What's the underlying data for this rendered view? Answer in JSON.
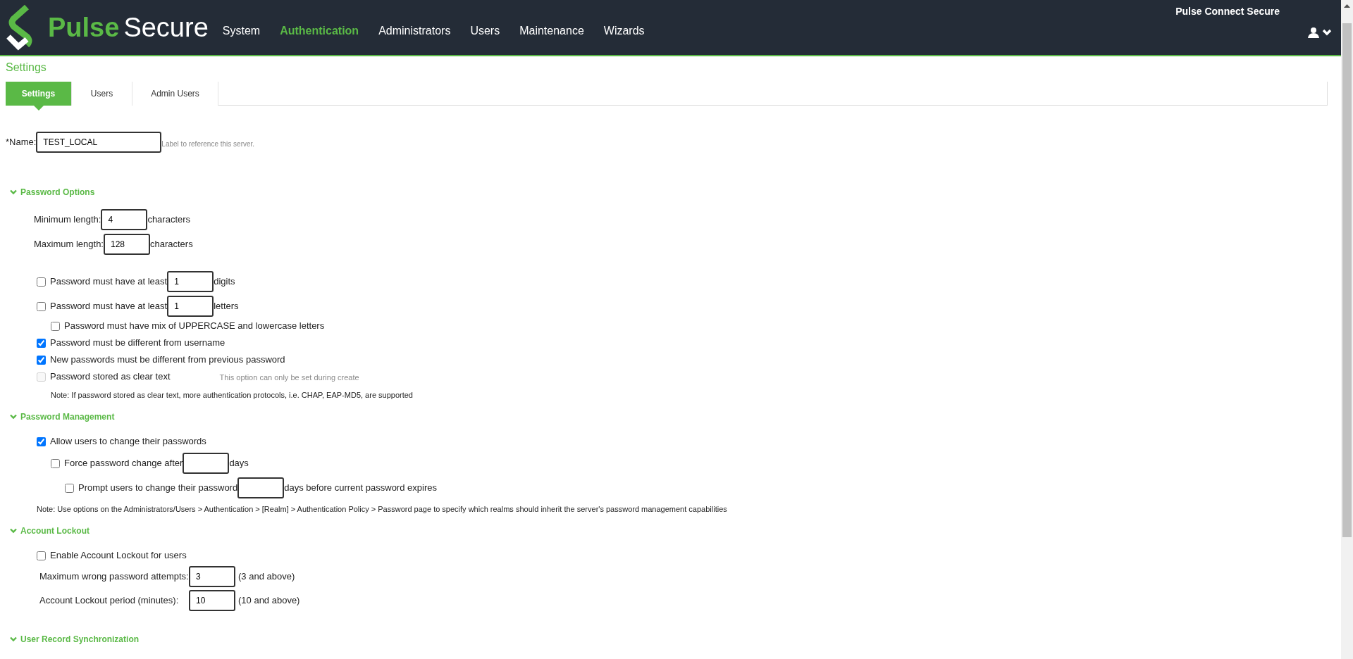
{
  "brand": {
    "first": "Pulse",
    "second": "Secure"
  },
  "product": "Pulse Connect Secure",
  "nav": [
    {
      "label": "System",
      "selected": false
    },
    {
      "label": "Authentication",
      "selected": true
    },
    {
      "label": "Administrators",
      "selected": false
    },
    {
      "label": "Users",
      "selected": false
    },
    {
      "label": "Maintenance",
      "selected": false
    },
    {
      "label": "Wizards",
      "selected": false
    }
  ],
  "page_title": "Settings",
  "tabs": [
    {
      "label": "Settings",
      "selected": true
    },
    {
      "label": "Users",
      "selected": false
    },
    {
      "label": "Admin Users",
      "selected": false
    }
  ],
  "name_field": {
    "label": "*Name:",
    "value": "TEST_LOCAL",
    "hint": "Label to reference this server."
  },
  "sections": [
    {
      "title": "Password Options",
      "expanded": true,
      "rows": [
        {
          "kind": "field",
          "label": "Minimum length:",
          "value": "4",
          "suffix": "characters"
        },
        {
          "kind": "field",
          "label": "Maximum length:",
          "value": "128",
          "suffix": "characters"
        },
        {
          "kind": "check_field",
          "checked": false,
          "label": "Password must have at least",
          "value": "1",
          "suffix": "digits"
        },
        {
          "kind": "check_field",
          "checked": false,
          "label": "Password must have at least",
          "value": "1",
          "suffix": "letters",
          "children": [
            {
              "kind": "check",
              "checked": false,
              "label": "Password must have mix of UPPERCASE and lowercase letters"
            }
          ]
        },
        {
          "kind": "check",
          "checked": true,
          "label": "Password must be different from username"
        },
        {
          "kind": "check",
          "checked": true,
          "label": "New passwords must be different from previous password"
        },
        {
          "kind": "check",
          "checked": false,
          "disabled": true,
          "label": "Password stored as clear text",
          "hint": "This option can only be set during create",
          "children": [
            {
              "kind": "note",
              "text": "Note: If password stored as clear text, more authentication protocols, i.e. CHAP, EAP-MD5, are supported"
            }
          ]
        }
      ]
    },
    {
      "title": "Password Management",
      "expanded": true,
      "rows": [
        {
          "kind": "check",
          "checked": true,
          "label": "Allow users to change their passwords",
          "children": [
            {
              "kind": "check_field",
              "checked": false,
              "label": "Force password change after",
              "suffix": "days",
              "children": [
                {
                  "kind": "check_field",
                  "checked": false,
                  "label": "Prompt users to change their password",
                  "suffix": "days before current password expires"
                }
              ]
            }
          ]
        },
        {
          "kind": "note",
          "text": "Note: Use options on the Administrators/Users > Authentication > [Realm] > Authentication Policy > Password page to specify which realms should inherit the server's password management capabilities"
        }
      ]
    },
    {
      "title": "Account Lockout",
      "expanded": true,
      "rows": [
        {
          "kind": "check",
          "checked": false,
          "label": "Enable Account Lockout for users"
        },
        {
          "kind": "aligned_field",
          "label": "Maximum wrong password attempts:",
          "value": "3",
          "suffix": "(3 and above)"
        },
        {
          "kind": "aligned_field",
          "label": "Account Lockout period (minutes):",
          "value": "10",
          "suffix": "(10 and above)"
        }
      ]
    },
    {
      "title": "User Record Synchronization",
      "expanded": true
    }
  ]
}
